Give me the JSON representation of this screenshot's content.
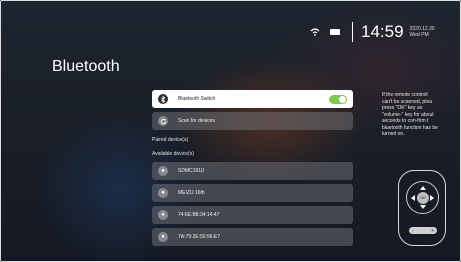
{
  "status": {
    "time": "14:59",
    "date_line1": "2020.12.30",
    "date_line2": "Wed PM"
  },
  "page": {
    "title": "Bluetooth"
  },
  "bluetooth_switch": {
    "label": "Bluetooth Switch",
    "enabled": true,
    "toggle_color": "#7ec84f"
  },
  "scan": {
    "label": "Scan for devices"
  },
  "paired": {
    "heading": "Paired device(s)"
  },
  "available": {
    "heading": "Available device(s)",
    "devices": [
      {
        "name": "SDMC1910"
      },
      {
        "name": "MEIZU 16th"
      },
      {
        "name": "74:6E:B8:34:14:47"
      },
      {
        "name": "7A:79:2E:50:96:E7"
      }
    ]
  },
  "help": {
    "lines": [
      "If the remote controll",
      "can't be scanned, plea",
      "press \"OK\" key an",
      "\"volume-\" key for about",
      "seconds to con-firm t",
      "bluetooth function has be",
      "turned on."
    ]
  },
  "remote": {
    "ok_label": "OK",
    "vol_minus": "-",
    "vol_plus": "+"
  }
}
